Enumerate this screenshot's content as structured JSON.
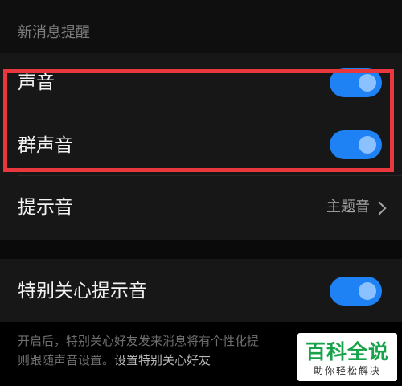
{
  "section_header": "新消息提醒",
  "rows": [
    {
      "label": "声音",
      "type": "toggle",
      "on": true
    },
    {
      "label": "群声音",
      "type": "toggle",
      "on": true
    },
    {
      "label": "提示音",
      "type": "nav",
      "value": "主题音"
    }
  ],
  "special": {
    "label": "特别关心提示音",
    "type": "toggle",
    "on": true
  },
  "footnote": {
    "line1": "开启后，特别关心好友发来消息将有个性化提",
    "line2_prefix": "则跟随声音设置。",
    "link": "设置特别关心好友"
  },
  "watermark": {
    "title": "百科全说",
    "subtitle": "助你轻松解决"
  },
  "colors": {
    "toggle_on": "#1e82f5",
    "highlight": "#e8383d",
    "watermark_green": "#16a34a"
  }
}
